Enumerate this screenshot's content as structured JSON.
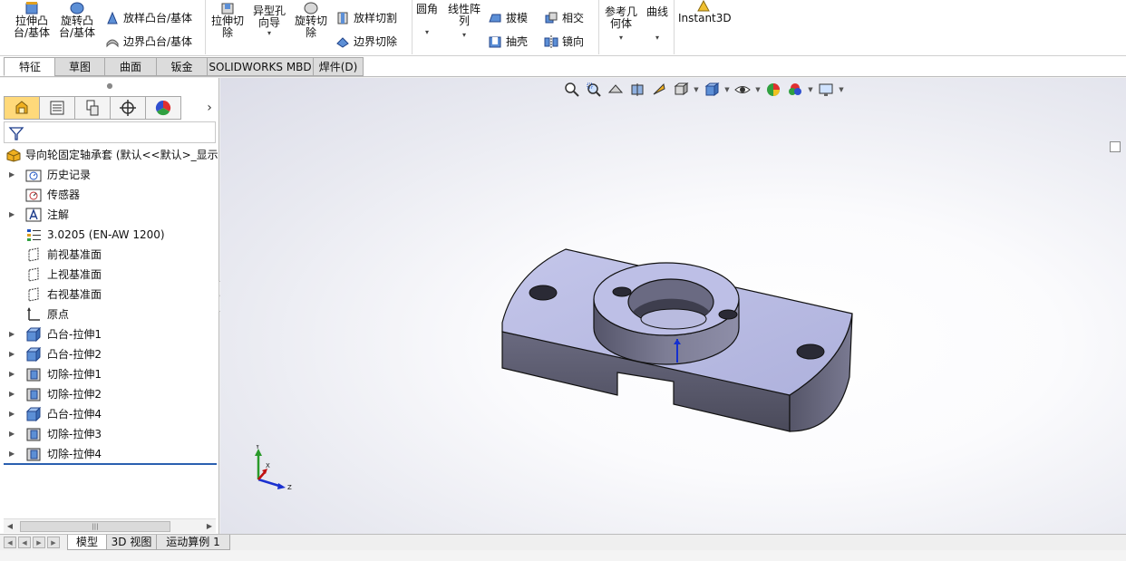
{
  "ribbon": {
    "extrude_boss": "拉伸凸\n台/基体",
    "revolve_boss": "旋转凸\n台/基体",
    "loft_boss": "放样凸台/基体",
    "boundary_boss": "边界凸台/基体",
    "extrude_cut": "拉伸切\n除",
    "hole_wizard": "异型孔\n向导",
    "revolve_cut": "旋转切\n除",
    "loft_cut": "放样切割",
    "boundary_cut": "边界切除",
    "fillet": "圆角",
    "linear_pattern": "线性阵\n列",
    "draft": "拔模",
    "shell": "抽壳",
    "intersect": "相交",
    "mirror": "镜向",
    "ref_geometry": "参考几\n何体",
    "curves": "曲线",
    "instant3d": "Instant3D"
  },
  "tabs": [
    "特征",
    "草图",
    "曲面",
    "钣金",
    "SOLIDWORKS MBD",
    "焊件(D)"
  ],
  "active_tab": "特征",
  "feature_tree": {
    "root": "导向轮固定轴承套  (默认<<默认>_显示",
    "items": [
      {
        "label": "历史记录",
        "icon": "history-folder-icon",
        "expandable": true
      },
      {
        "label": "传感器",
        "icon": "sensor-icon",
        "expandable": false
      },
      {
        "label": "注解",
        "icon": "annotation-icon",
        "expandable": true
      },
      {
        "label": "3.0205 (EN-AW 1200)",
        "icon": "material-icon",
        "expandable": false
      },
      {
        "label": "前视基准面",
        "icon": "plane-icon",
        "expandable": false
      },
      {
        "label": "上视基准面",
        "icon": "plane-icon",
        "expandable": false
      },
      {
        "label": "右视基准面",
        "icon": "plane-icon",
        "expandable": false
      },
      {
        "label": "原点",
        "icon": "origin-icon",
        "expandable": false
      },
      {
        "label": "凸台-拉伸1",
        "icon": "boss-extrude-icon",
        "expandable": true
      },
      {
        "label": "凸台-拉伸2",
        "icon": "boss-extrude-icon",
        "expandable": true
      },
      {
        "label": "切除-拉伸1",
        "icon": "cut-extrude-icon",
        "expandable": true
      },
      {
        "label": "切除-拉伸2",
        "icon": "cut-extrude-icon",
        "expandable": true
      },
      {
        "label": "凸台-拉伸4",
        "icon": "boss-extrude-icon",
        "expandable": true
      },
      {
        "label": "切除-拉伸3",
        "icon": "cut-extrude-icon",
        "expandable": true
      },
      {
        "label": "切除-拉伸4",
        "icon": "cut-extrude-icon",
        "expandable": true
      }
    ]
  },
  "triad": {
    "x": "X",
    "y": "Y",
    "z": "Z"
  },
  "bottom_tabs": [
    "模型",
    "3D 视图",
    "运动算例 1"
  ],
  "active_bottom_tab": "模型",
  "colors": {
    "accent_blue": "#2a5fb0",
    "model_face": "#b8bbe0",
    "model_side": "#5a5a70",
    "active_panel_tab": "#ffd97a"
  }
}
